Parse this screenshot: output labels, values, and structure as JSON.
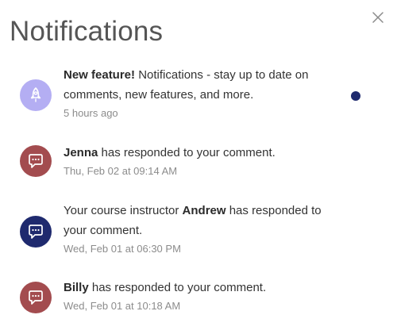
{
  "header": {
    "title": "Notifications",
    "close_icon": "close-icon"
  },
  "colors": {
    "feature_avatar": "#b4aef3",
    "comment_avatar_red": "#a34c4f",
    "comment_avatar_navy": "#1f2a6e",
    "unread_dot": "#1f2a6e"
  },
  "notifications": [
    {
      "icon": "rocket-icon",
      "bold": "New feature!",
      "text": " Notifications - stay up to date on comments, new features, and more.",
      "time": "5 hours ago",
      "unread": true
    },
    {
      "icon": "chat-bubble-icon",
      "bold": "Jenna",
      "text": " has responded to your comment.",
      "time": "Thu, Feb 02 at 09:14 AM",
      "unread": false
    },
    {
      "icon": "chat-bubble-icon",
      "prefix": "Your course instructor ",
      "bold": "Andrew",
      "text": " has responded to your comment.",
      "time": "Wed, Feb 01 at 06:30 PM",
      "unread": false
    },
    {
      "icon": "chat-bubble-icon",
      "bold": "Billy",
      "text": " has responded to your comment.",
      "time": "Wed, Feb 01 at 10:18 AM",
      "unread": false
    }
  ]
}
